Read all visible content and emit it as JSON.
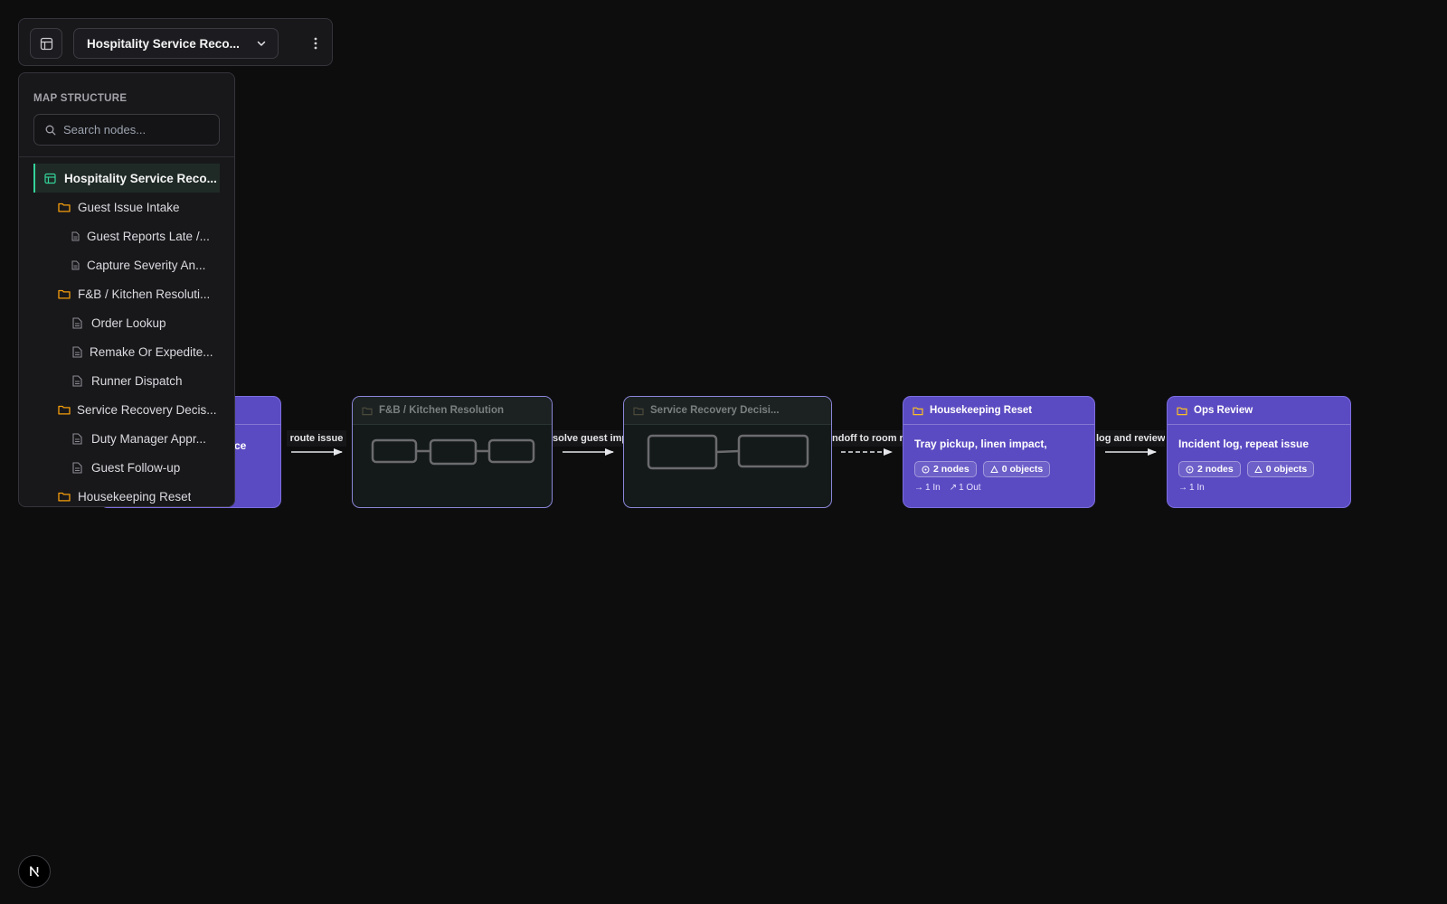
{
  "toolbar": {
    "map_title": "Hospitality Service Reco..."
  },
  "sidebar": {
    "title": "MAP STRUCTURE",
    "search_placeholder": "Search nodes...",
    "items": [
      {
        "label": "Hospitality Service Reco...",
        "type": "map",
        "level": 0,
        "active": true
      },
      {
        "label": "Guest Issue Intake",
        "type": "folder",
        "level": 1
      },
      {
        "label": "Guest Reports Late /...",
        "type": "doc",
        "level": 2
      },
      {
        "label": "Capture Severity An...",
        "type": "doc",
        "level": 2
      },
      {
        "label": "F&B / Kitchen Resoluti...",
        "type": "folder",
        "level": 1
      },
      {
        "label": "Order Lookup",
        "type": "doc",
        "level": 2
      },
      {
        "label": "Remake Or Expedite...",
        "type": "doc",
        "level": 2
      },
      {
        "label": "Runner Dispatch",
        "type": "doc",
        "level": 2
      },
      {
        "label": "Service Recovery Decis...",
        "type": "folder",
        "level": 1
      },
      {
        "label": "Duty Manager Appr...",
        "type": "doc",
        "level": 2
      },
      {
        "label": "Guest Follow-up",
        "type": "doc",
        "level": 2
      },
      {
        "label": "Housekeeping Reset",
        "type": "folder",
        "level": 1
      }
    ]
  },
  "canvas": {
    "nodes": {
      "intake": {
        "partial_desc": "ce"
      },
      "fnb": {
        "title": "F&B / Kitchen Resolution"
      },
      "recovery": {
        "title": "Service Recovery Decisi..."
      },
      "housekeeping": {
        "title": "Housekeeping Reset",
        "desc": "Tray pickup, linen impact,",
        "nodes_chip": "2 nodes",
        "objects_chip": "0 objects",
        "in": "1 In",
        "out": "1 Out"
      },
      "ops": {
        "title": "Ops Review",
        "desc": "Incident log, repeat issue",
        "nodes_chip": "2 nodes",
        "objects_chip": "0 objects",
        "in": "1 In"
      }
    },
    "edges": [
      {
        "label": "route issue",
        "style": "solid"
      },
      {
        "label": "solve guest impa",
        "style": "solid"
      },
      {
        "label": "ndoff to room re",
        "style": "dashed"
      },
      {
        "label": "log and review",
        "style": "solid"
      }
    ]
  },
  "colors": {
    "accent": "#34d399",
    "node_purple": "#5b4bc2",
    "folder": "#f59e0b"
  }
}
